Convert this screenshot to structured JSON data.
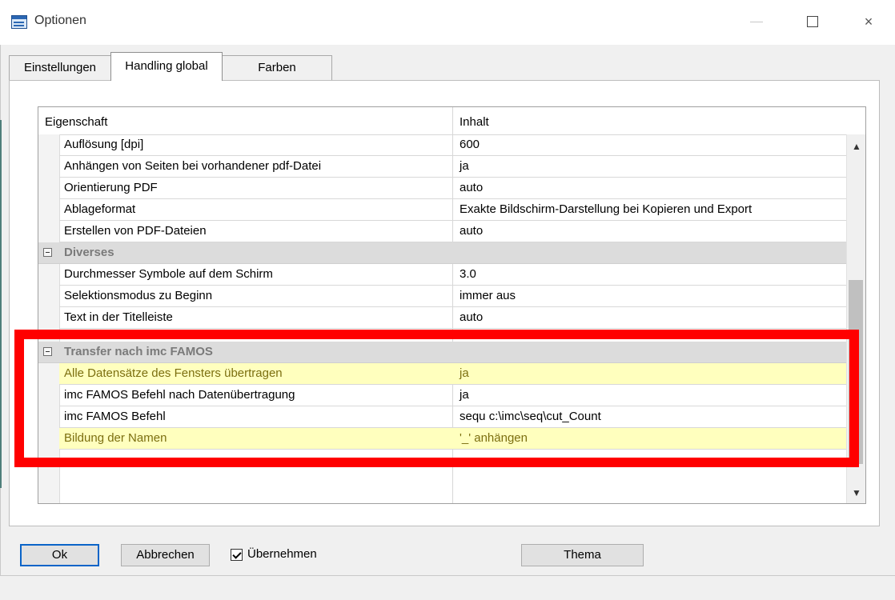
{
  "window": {
    "title": "Optionen",
    "close_glyph": "×"
  },
  "tabs": [
    {
      "label": "Einstellungen"
    },
    {
      "label": "Handling global",
      "active": true
    },
    {
      "label": "Farben"
    }
  ],
  "grid": {
    "columns": [
      "Eigenschaft",
      "Inhalt"
    ],
    "rows": [
      {
        "type": "item",
        "property": "Auflösung [dpi]",
        "value": "600"
      },
      {
        "type": "item",
        "property": "Anhängen von Seiten bei vorhandener pdf-Datei",
        "value": "ja"
      },
      {
        "type": "item",
        "property": "Orientierung PDF",
        "value": "auto"
      },
      {
        "type": "item",
        "property": "Ablageformat",
        "value": "Exakte Bildschirm-Darstellung bei Kopieren und Export"
      },
      {
        "type": "item",
        "property": "Erstellen von PDF-Dateien",
        "value": "auto"
      },
      {
        "type": "category",
        "label": "Diverses"
      },
      {
        "type": "item",
        "property": "Durchmesser Symbole auf dem Schirm",
        "value": "3.0"
      },
      {
        "type": "item",
        "property": "Selektionsmodus zu Beginn",
        "value": "immer aus"
      },
      {
        "type": "item",
        "property": "Text in der Titelleiste",
        "value": "auto"
      },
      {
        "type": "category",
        "label": "Transfer nach imc FAMOS"
      },
      {
        "type": "item",
        "property": "Alle Datensätze des Fensters übertragen",
        "value": "ja",
        "highlight": true
      },
      {
        "type": "item",
        "property": "imc FAMOS Befehl nach Datenübertragung",
        "value": "ja"
      },
      {
        "type": "item",
        "property": "imc FAMOS Befehl",
        "value": "sequ c:\\imc\\seq\\cut_Count"
      },
      {
        "type": "item",
        "property": "Bildung der Namen",
        "value": "'_' anhängen",
        "highlight": true
      }
    ]
  },
  "buttons": {
    "ok": "Ok",
    "cancel": "Abbrechen",
    "apply_checkbox": "Übernehmen",
    "theme": "Thema"
  },
  "colors": {
    "annotation": "#ff0000",
    "highlight_row": "#ffffbe",
    "focus_blue": "#0a64c8"
  }
}
